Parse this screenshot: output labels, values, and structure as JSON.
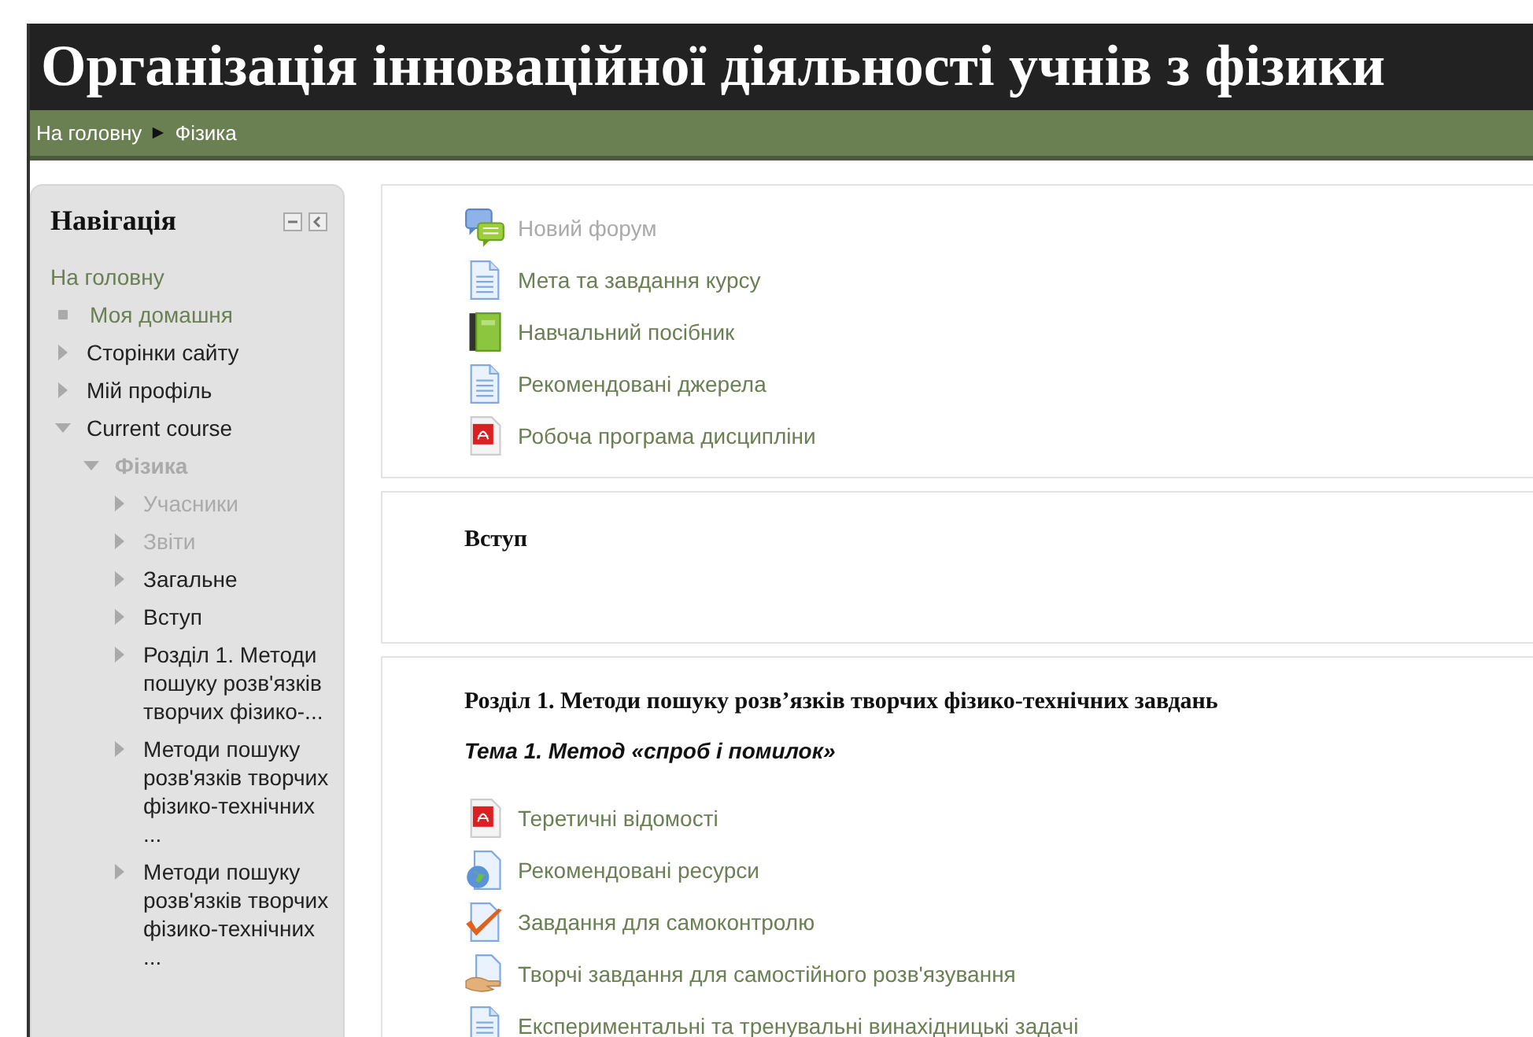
{
  "header": {
    "title": "Організація інноваційної діяльності учнів з фізики"
  },
  "breadcrumb": [
    {
      "label": "На головну"
    },
    {
      "label": "Фізика"
    }
  ],
  "navigation": {
    "title": "Навігація",
    "items": [
      {
        "label": "На головну",
        "kind": "root",
        "link": true,
        "dimmed": false
      },
      {
        "label": "Моя домашня",
        "kind": "bullet",
        "link": true,
        "dimmed": false
      },
      {
        "label": "Сторінки сайту",
        "kind": "branch",
        "expanded": false,
        "link": false,
        "dimmed": false
      },
      {
        "label": "Мій профіль",
        "kind": "branch",
        "expanded": false,
        "link": false,
        "dimmed": false
      },
      {
        "label": "Current course",
        "kind": "branch",
        "expanded": true,
        "link": false,
        "dimmed": false,
        "children": [
          {
            "label": "Фізика",
            "kind": "branch",
            "expanded": true,
            "link": false,
            "dimmed": true,
            "bold": true,
            "children": [
              {
                "label": "Учасники",
                "kind": "branch",
                "expanded": false,
                "link": false,
                "dimmed": true
              },
              {
                "label": "Звіти",
                "kind": "branch",
                "expanded": false,
                "link": false,
                "dimmed": true
              },
              {
                "label": "Загальне",
                "kind": "branch",
                "expanded": false,
                "link": false,
                "dimmed": false
              },
              {
                "label": "Вступ",
                "kind": "branch",
                "expanded": false,
                "link": false,
                "dimmed": false
              },
              {
                "label": "Розділ 1. Методи пошуку розв'язків творчих фізико-...",
                "kind": "branch",
                "expanded": false,
                "link": false,
                "dimmed": false
              },
              {
                "label": "Методи пошуку розв'язків творчих фізико-технічних ...",
                "kind": "branch",
                "expanded": false,
                "link": false,
                "dimmed": false
              },
              {
                "label": "Методи пошуку розв'язків творчих фізико-технічних ...",
                "kind": "branch",
                "expanded": false,
                "link": false,
                "dimmed": false
              }
            ]
          }
        ]
      }
    ]
  },
  "sections": [
    {
      "activities": [
        {
          "label": "Новий форум",
          "kind": "forum",
          "dimmed": true
        },
        {
          "label": "Мета та завдання курсу",
          "kind": "page",
          "dimmed": false
        },
        {
          "label": "Навчальний посібник",
          "kind": "book",
          "dimmed": false
        },
        {
          "label": "Рекомендовані джерела",
          "kind": "page",
          "dimmed": false
        },
        {
          "label": "Робоча програма дисципліни",
          "kind": "pdf",
          "dimmed": false
        }
      ]
    },
    {
      "title": "Вступ"
    },
    {
      "title": "Розділ 1. Методи пошуку розв’язків творчих фізико-технічних завдань",
      "subtitle": "Тема 1. Метод «спроб і помилок»",
      "activities": [
        {
          "label": "Теретичні відомості",
          "kind": "pdf",
          "dimmed": false
        },
        {
          "label": "Рекомендовані ресурси",
          "kind": "url",
          "dimmed": false
        },
        {
          "label": "Завдання для самоконтролю",
          "kind": "quiz",
          "dimmed": false
        },
        {
          "label": "Творчі завдання для самостійного розв'язування",
          "kind": "assign",
          "dimmed": false
        },
        {
          "label": "Експериментальні та тренувальні винахідницькі задачі",
          "kind": "page",
          "dimmed": false
        }
      ]
    }
  ]
}
